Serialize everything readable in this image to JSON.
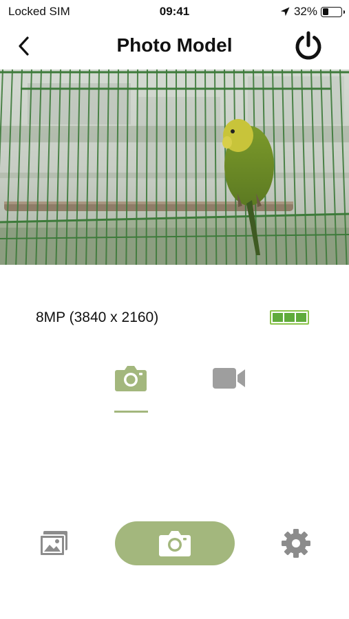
{
  "status_bar": {
    "carrier": "Locked SIM",
    "time": "09:41",
    "battery_percent": "32%",
    "battery_level": 0.32,
    "icons": [
      "location-arrow-icon",
      "battery-icon"
    ]
  },
  "nav": {
    "title": "Photo Model",
    "back_icon": "chevron-left-icon",
    "power_icon": "power-icon"
  },
  "preview": {
    "subject": "camera-live-preview"
  },
  "info": {
    "resolution": "8MP (3840 x 2160)",
    "battery_cells_filled": 3,
    "battery_cells_total": 3
  },
  "modes": {
    "selected": "photo",
    "items": [
      {
        "id": "photo",
        "icon": "camera-icon"
      },
      {
        "id": "video",
        "icon": "video-camera-icon"
      }
    ]
  },
  "toolbar": {
    "gallery_icon": "gallery-icon",
    "shutter_icon": "camera-icon",
    "settings_icon": "gear-icon"
  },
  "colors": {
    "accent": "#a3b77d",
    "inactive_icon": "#9e9e9e",
    "battery_green": "#5fab3b",
    "battery_border": "#8bc34a",
    "text": "#111111"
  }
}
